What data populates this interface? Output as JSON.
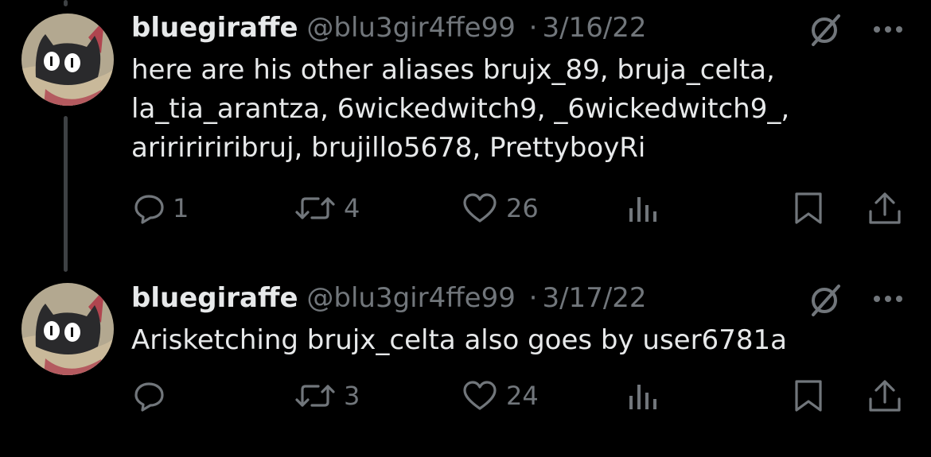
{
  "colors": {
    "background": "#000000",
    "text_primary": "#e7e9ea",
    "text_secondary": "#71767b",
    "thread_line": "#3e4144"
  },
  "tweets": [
    {
      "display_name": "bluegiraffe",
      "handle": "@blu3gir4ffe99",
      "separator": "·",
      "date": "3/16/22",
      "text": "here are his other aliases brujx_89, bruja_celta,\nla_tia_arantza, 6wickedwitch9, _6wickedwitch9_,\naririririribruj, brujillo5678, PrettyboyRi",
      "reply_count": "1",
      "repost_count": "4",
      "like_count": "26"
    },
    {
      "display_name": "bluegiraffe",
      "handle": "@blu3gir4ffe99",
      "separator": "·",
      "date": "3/17/22",
      "text": "Arisketching brujx_celta also goes by user6781a",
      "reply_count": "",
      "repost_count": "3",
      "like_count": "24"
    }
  ],
  "icons": {
    "reply": "reply-bubble-icon",
    "repost": "repost-arrows-icon",
    "like": "heart-icon",
    "views": "views-bars-icon",
    "bookmark": "bookmark-icon",
    "share": "share-upload-icon",
    "grok": "grok-slash-circle-icon",
    "more": "more-dots-icon"
  }
}
